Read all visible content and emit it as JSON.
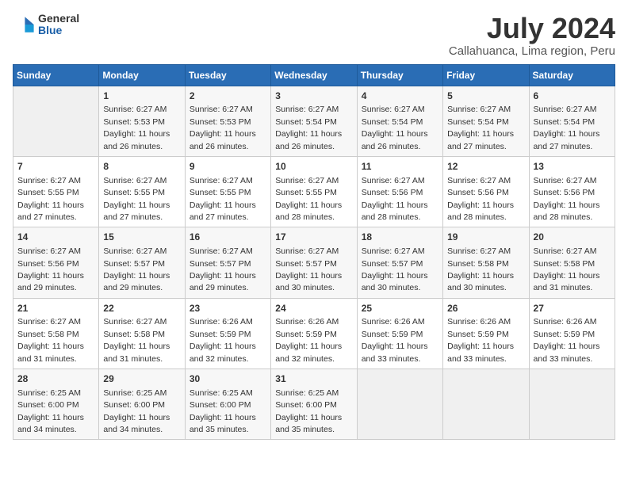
{
  "logo": {
    "general": "General",
    "blue": "Blue"
  },
  "title": "July 2024",
  "location": "Callahuanca, Lima region, Peru",
  "headers": [
    "Sunday",
    "Monday",
    "Tuesday",
    "Wednesday",
    "Thursday",
    "Friday",
    "Saturday"
  ],
  "weeks": [
    [
      {
        "day": "",
        "info": ""
      },
      {
        "day": "1",
        "info": "Sunrise: 6:27 AM\nSunset: 5:53 PM\nDaylight: 11 hours\nand 26 minutes."
      },
      {
        "day": "2",
        "info": "Sunrise: 6:27 AM\nSunset: 5:53 PM\nDaylight: 11 hours\nand 26 minutes."
      },
      {
        "day": "3",
        "info": "Sunrise: 6:27 AM\nSunset: 5:54 PM\nDaylight: 11 hours\nand 26 minutes."
      },
      {
        "day": "4",
        "info": "Sunrise: 6:27 AM\nSunset: 5:54 PM\nDaylight: 11 hours\nand 26 minutes."
      },
      {
        "day": "5",
        "info": "Sunrise: 6:27 AM\nSunset: 5:54 PM\nDaylight: 11 hours\nand 27 minutes."
      },
      {
        "day": "6",
        "info": "Sunrise: 6:27 AM\nSunset: 5:54 PM\nDaylight: 11 hours\nand 27 minutes."
      }
    ],
    [
      {
        "day": "7",
        "info": "Sunrise: 6:27 AM\nSunset: 5:55 PM\nDaylight: 11 hours\nand 27 minutes."
      },
      {
        "day": "8",
        "info": "Sunrise: 6:27 AM\nSunset: 5:55 PM\nDaylight: 11 hours\nand 27 minutes."
      },
      {
        "day": "9",
        "info": "Sunrise: 6:27 AM\nSunset: 5:55 PM\nDaylight: 11 hours\nand 27 minutes."
      },
      {
        "day": "10",
        "info": "Sunrise: 6:27 AM\nSunset: 5:55 PM\nDaylight: 11 hours\nand 28 minutes."
      },
      {
        "day": "11",
        "info": "Sunrise: 6:27 AM\nSunset: 5:56 PM\nDaylight: 11 hours\nand 28 minutes."
      },
      {
        "day": "12",
        "info": "Sunrise: 6:27 AM\nSunset: 5:56 PM\nDaylight: 11 hours\nand 28 minutes."
      },
      {
        "day": "13",
        "info": "Sunrise: 6:27 AM\nSunset: 5:56 PM\nDaylight: 11 hours\nand 28 minutes."
      }
    ],
    [
      {
        "day": "14",
        "info": "Sunrise: 6:27 AM\nSunset: 5:56 PM\nDaylight: 11 hours\nand 29 minutes."
      },
      {
        "day": "15",
        "info": "Sunrise: 6:27 AM\nSunset: 5:57 PM\nDaylight: 11 hours\nand 29 minutes."
      },
      {
        "day": "16",
        "info": "Sunrise: 6:27 AM\nSunset: 5:57 PM\nDaylight: 11 hours\nand 29 minutes."
      },
      {
        "day": "17",
        "info": "Sunrise: 6:27 AM\nSunset: 5:57 PM\nDaylight: 11 hours\nand 30 minutes."
      },
      {
        "day": "18",
        "info": "Sunrise: 6:27 AM\nSunset: 5:57 PM\nDaylight: 11 hours\nand 30 minutes."
      },
      {
        "day": "19",
        "info": "Sunrise: 6:27 AM\nSunset: 5:58 PM\nDaylight: 11 hours\nand 30 minutes."
      },
      {
        "day": "20",
        "info": "Sunrise: 6:27 AM\nSunset: 5:58 PM\nDaylight: 11 hours\nand 31 minutes."
      }
    ],
    [
      {
        "day": "21",
        "info": "Sunrise: 6:27 AM\nSunset: 5:58 PM\nDaylight: 11 hours\nand 31 minutes."
      },
      {
        "day": "22",
        "info": "Sunrise: 6:27 AM\nSunset: 5:58 PM\nDaylight: 11 hours\nand 31 minutes."
      },
      {
        "day": "23",
        "info": "Sunrise: 6:26 AM\nSunset: 5:59 PM\nDaylight: 11 hours\nand 32 minutes."
      },
      {
        "day": "24",
        "info": "Sunrise: 6:26 AM\nSunset: 5:59 PM\nDaylight: 11 hours\nand 32 minutes."
      },
      {
        "day": "25",
        "info": "Sunrise: 6:26 AM\nSunset: 5:59 PM\nDaylight: 11 hours\nand 33 minutes."
      },
      {
        "day": "26",
        "info": "Sunrise: 6:26 AM\nSunset: 5:59 PM\nDaylight: 11 hours\nand 33 minutes."
      },
      {
        "day": "27",
        "info": "Sunrise: 6:26 AM\nSunset: 5:59 PM\nDaylight: 11 hours\nand 33 minutes."
      }
    ],
    [
      {
        "day": "28",
        "info": "Sunrise: 6:25 AM\nSunset: 6:00 PM\nDaylight: 11 hours\nand 34 minutes."
      },
      {
        "day": "29",
        "info": "Sunrise: 6:25 AM\nSunset: 6:00 PM\nDaylight: 11 hours\nand 34 minutes."
      },
      {
        "day": "30",
        "info": "Sunrise: 6:25 AM\nSunset: 6:00 PM\nDaylight: 11 hours\nand 35 minutes."
      },
      {
        "day": "31",
        "info": "Sunrise: 6:25 AM\nSunset: 6:00 PM\nDaylight: 11 hours\nand 35 minutes."
      },
      {
        "day": "",
        "info": ""
      },
      {
        "day": "",
        "info": ""
      },
      {
        "day": "",
        "info": ""
      }
    ]
  ]
}
